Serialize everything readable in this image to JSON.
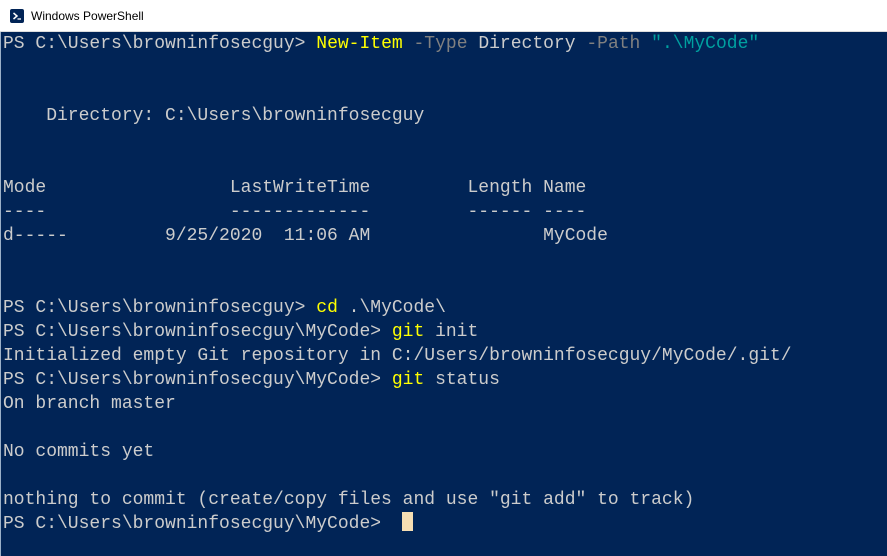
{
  "window": {
    "title": "Windows PowerShell",
    "icon": "powershell-icon"
  },
  "colors": {
    "background": "#012456",
    "text": "#cccccc",
    "command": "#ffff00",
    "parameter": "#808080",
    "string": "#00a0a0"
  },
  "lines": {
    "l1": {
      "prompt": "PS C:\\Users\\browninfosecguy> ",
      "cmd": "New-Item",
      "sp1": " ",
      "p1": "-Type",
      "a1": " Directory ",
      "p2": "-Path",
      "sp2": " ",
      "str": "\".\\MyCode\""
    },
    "l4": "    Directory: C:\\Users\\browninfosecguy",
    "l7": "Mode                 LastWriteTime         Length Name",
    "l8": "----                 -------------         ------ ----",
    "l9": "d-----         9/25/2020  11:06 AM                MyCode",
    "l13": {
      "prompt": "PS C:\\Users\\browninfosecguy> ",
      "cmd": "cd",
      "arg": " .\\MyCode\\"
    },
    "l14": {
      "prompt": "PS C:\\Users\\browninfosecguy\\MyCode> ",
      "cmd": "git",
      "arg": " init"
    },
    "l15": "Initialized empty Git repository in C:/Users/browninfosecguy/MyCode/.git/",
    "l16": {
      "prompt": "PS C:\\Users\\browninfosecguy\\MyCode> ",
      "cmd": "git",
      "arg": " status"
    },
    "l17": "On branch master",
    "l19": "No commits yet",
    "l21": "nothing to commit (create/copy files and use \"git add\" to track)",
    "l22": {
      "prompt": "PS C:\\Users\\browninfosecguy\\MyCode> "
    }
  }
}
